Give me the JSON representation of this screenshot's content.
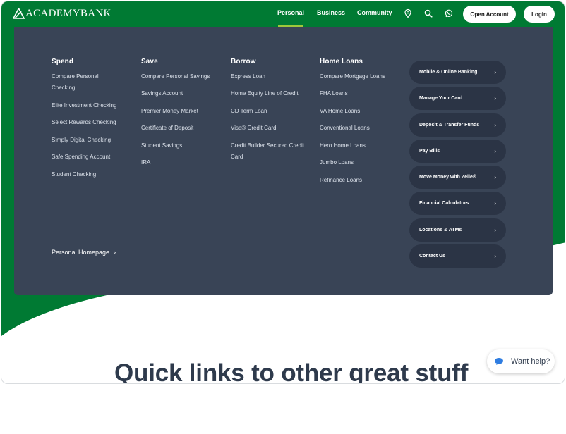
{
  "brand": {
    "name": "ACADEMYBANK",
    "logo_icon": "academy-bank-logo-icon",
    "green": "#007a33",
    "accent": "#9dc83b"
  },
  "nav": {
    "links": [
      "Personal",
      "Business",
      "Community"
    ],
    "active": "Personal",
    "icons": [
      "location-pin-icon",
      "search-icon",
      "whatsapp-icon"
    ],
    "open_account": "Open Account",
    "login": "Login"
  },
  "menu": {
    "columns": [
      {
        "title": "Spend",
        "items": [
          "Compare Personal Checking",
          "Elite Investment Checking",
          "Select Rewards Checking",
          "Simply Digital Checking",
          "Safe Spending Account",
          "Student Checking"
        ]
      },
      {
        "title": "Save",
        "items": [
          "Compare Personal Savings",
          "Savings Account",
          "Premier Money Market",
          "Certificate of Deposit",
          "Student Savings",
          "IRA"
        ]
      },
      {
        "title": "Borrow",
        "items": [
          "Express Loan",
          "Home Equity Line of Credit",
          "CD Term Loan",
          "Visa® Credit Card",
          "Credit Builder Secured Credit Card"
        ]
      },
      {
        "title": "Home Loans",
        "items": [
          "Compare Mortgage Loans",
          "FHA Loans",
          "VA Home Loans",
          "Conventional Loans",
          "Hero Home Loans",
          "Jumbo Loans",
          "Refinance Loans"
        ]
      }
    ],
    "personal_homepage": "Personal Homepage",
    "quick_links": [
      "Mobile & Online Banking",
      "Manage Your Card",
      "Deposit & Transfer Funds",
      "Pay Bills",
      "Move Money with Zelle®",
      "Financial Calculators",
      "Locations & ATMs",
      "Contact Us"
    ],
    "chevron": "›"
  },
  "page": {
    "section_title": "Quick links to other great stuff"
  },
  "help": {
    "label": "Want help?",
    "icon": "chat-bubble-icon"
  }
}
